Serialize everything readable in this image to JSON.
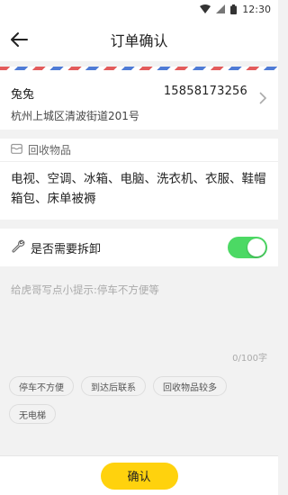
{
  "status_bar": {
    "time": "12:30",
    "icons": [
      "wifi-icon",
      "signal-icon",
      "battery-icon"
    ]
  },
  "header": {
    "title": "订单确认",
    "back_icon": "arrow-left-icon"
  },
  "address": {
    "name": "兔兔",
    "phone": "15858173256",
    "detail": "杭州上城区清波街道201号",
    "chevron_icon": "chevron-right-icon"
  },
  "goods": {
    "heading": "回收物品",
    "icon": "box-icon",
    "items_text": "电视、空调、冰箱、电脑、洗衣机、衣服、鞋帽箱包、床单被褥"
  },
  "dismantle": {
    "label": "是否需要拆卸",
    "icon": "wrench-icon",
    "enabled": true,
    "switch_color": "#4cd964"
  },
  "note": {
    "placeholder": "给虎哥写点小提示:停车不方便等",
    "value": "",
    "counter": "0/100字"
  },
  "quick_tags": [
    "停车不方便",
    "到达后联系",
    "回收物品较多",
    "无电梯"
  ],
  "footer": {
    "confirm_label": "确认",
    "accent": "#ffd20d"
  }
}
